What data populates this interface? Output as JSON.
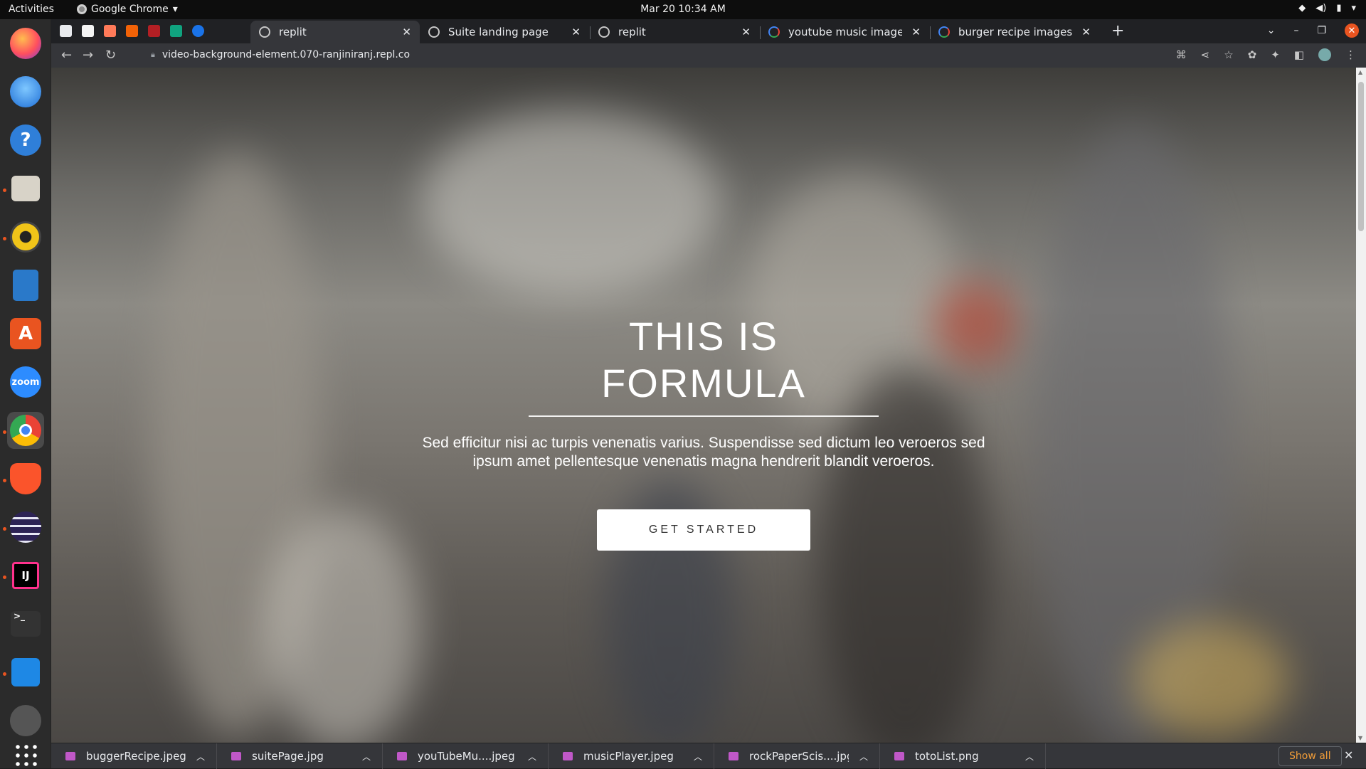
{
  "topbar": {
    "activities": "Activities",
    "app_name": "Google Chrome",
    "datetime": "Mar 20  10:34 AM"
  },
  "dock": {
    "apps": [
      "firefox",
      "thunderbird",
      "help",
      "files",
      "rhythmbox",
      "libreoffice-writer",
      "software-center",
      "zoom",
      "chrome",
      "brave",
      "eclipse",
      "intellij",
      "terminal",
      "vscode",
      "screenshot",
      "app-grid"
    ],
    "zoom_label": "zoom",
    "intellij_label": "IJ",
    "terminal_label": ">_"
  },
  "browser": {
    "tabs": [
      {
        "title": "replit",
        "active": true
      },
      {
        "title": "Suite landing page",
        "active": false
      },
      {
        "title": "replit",
        "active": false
      },
      {
        "title": "youtube music images - G",
        "active": false
      },
      {
        "title": "burger recipe images - Go",
        "active": false
      }
    ],
    "new_tab": "+",
    "url": "video-background-element.070-ranjiniranj.repl.co"
  },
  "page": {
    "title_line1": "THIS IS",
    "title_line2": "FORMULA",
    "description": "Sed efficitur nisi ac turpis venenatis varius. Suspendisse sed dictum leo veroeros sed ipsum amet pellentesque venenatis magna hendrerit blandit veroeros.",
    "cta": "GET STARTED"
  },
  "downloads": {
    "items": [
      "buggerRecipe.jpeg",
      "suitePage.jpg",
      "youTubeMu....jpeg",
      "musicPlayer.jpeg",
      "rockPaperScis....jpg",
      "totoList.png"
    ],
    "show_all": "Show all"
  },
  "colors": {
    "accent_orange": "#e95420",
    "chrome_dark": "#202124",
    "chrome_toolbar": "#35363a",
    "show_all": "#f29d38"
  }
}
